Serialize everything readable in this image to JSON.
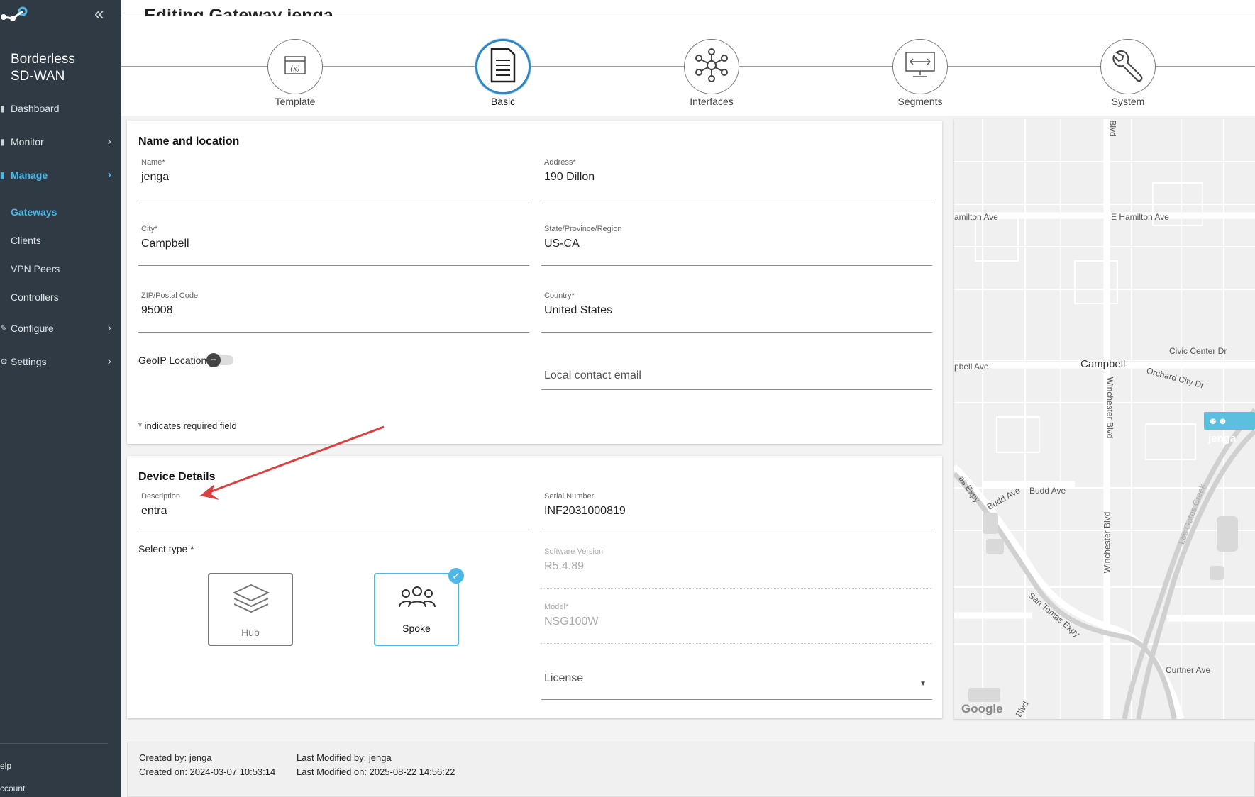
{
  "sidebar": {
    "brand": "Borderless SD-WAN",
    "items": [
      {
        "label": "Dashboard"
      },
      {
        "label": "Monitor"
      },
      {
        "label": "Manage"
      },
      {
        "label": "Configure"
      },
      {
        "label": "Settings"
      }
    ],
    "sub_items": [
      {
        "label": "Gateways"
      },
      {
        "label": "Clients"
      },
      {
        "label": "VPN Peers"
      },
      {
        "label": "Controllers"
      }
    ],
    "footer": [
      {
        "label": "elp"
      },
      {
        "label": "ccount"
      }
    ]
  },
  "page": {
    "title": "Editing Gateway jenga"
  },
  "steps": [
    {
      "label": "Template",
      "icon": "template-icon"
    },
    {
      "label": "Basic",
      "icon": "document-icon",
      "active": true
    },
    {
      "label": "Interfaces",
      "icon": "network-icon"
    },
    {
      "label": "Segments",
      "icon": "monitor-icon"
    },
    {
      "label": "System",
      "icon": "wrench-icon"
    }
  ],
  "name_location": {
    "title": "Name and location",
    "name_label": "Name*",
    "name_value": "jenga",
    "address_label": "Address*",
    "address_value": "190 Dillon",
    "city_label": "City*",
    "city_value": "Campbell",
    "state_label": "State/Province/Region",
    "state_value": "US-CA",
    "zip_label": "ZIP/Postal Code",
    "zip_value": "95008",
    "country_label": "Country*",
    "country_value": "United States",
    "geoip_label": "GeoIP Location",
    "geoip_enabled": false,
    "email_placeholder": "Local contact email",
    "required_note": "* indicates required field"
  },
  "device": {
    "title": "Device Details",
    "description_label": "Description",
    "description_value": "entra",
    "serial_label": "Serial Number",
    "serial_value": "INF2031000819",
    "select_type_label": "Select type *",
    "types": [
      {
        "label": "Hub",
        "selected": false
      },
      {
        "label": "Spoke",
        "selected": true
      }
    ],
    "software_label": "Software Version",
    "software_value": "R5.4.89",
    "model_label": "Model*",
    "model_value": "NSG100W",
    "license_label": "License"
  },
  "map": {
    "labels": [
      "Blvd",
      "amilton Ave",
      "E Hamilton Ave",
      "Civic Center Dr",
      "pbell Ave",
      "Campbell",
      "Orchard City Dr",
      "Winchester Blvd",
      "as Expy",
      "Budd Ave",
      "Budd Ave",
      "Winchester Blvd",
      "Los Gatos Creek",
      "San Tomas Expy",
      "Curtner Ave",
      "Blvd"
    ],
    "pin_label": "jenga",
    "attribution": "Google"
  },
  "info": {
    "created_by": "Created by: jenga",
    "created_on": "Created on: 2024-03-07 10:53:14",
    "modified_by": "Last Modified by: jenga",
    "modified_on": "Last Modified on: 2025-08-22 14:56:22"
  },
  "colors": {
    "sidebar_bg": "#2f3a45",
    "accent": "#4db7e8",
    "active_step": "#2e86c1",
    "annotation_arrow": "#d9403f"
  }
}
